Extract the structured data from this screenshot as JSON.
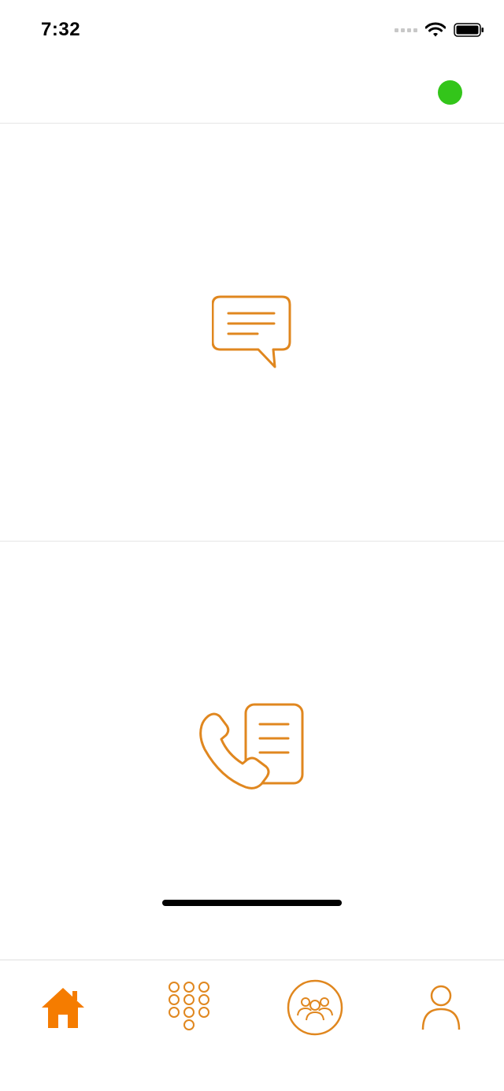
{
  "status_bar": {
    "time": "7:32",
    "icons": [
      "signal-icon",
      "wifi-icon",
      "battery-icon"
    ]
  },
  "header": {
    "presence_status_color": "#33c51a"
  },
  "panels": [
    {
      "name": "messages",
      "icon": "chat-bubble-icon"
    },
    {
      "name": "call-log",
      "icon": "phone-document-icon"
    }
  ],
  "tab_bar": {
    "items": [
      {
        "name": "home",
        "icon": "home-icon",
        "active": true
      },
      {
        "name": "dialpad",
        "icon": "dialpad-icon",
        "active": false
      },
      {
        "name": "groups",
        "icon": "group-icon",
        "active": false
      },
      {
        "name": "profile",
        "icon": "user-icon",
        "active": false
      }
    ]
  },
  "colors": {
    "accent": "#e0871f",
    "active_tab": "#f57c00",
    "presence": "#33c51a"
  }
}
